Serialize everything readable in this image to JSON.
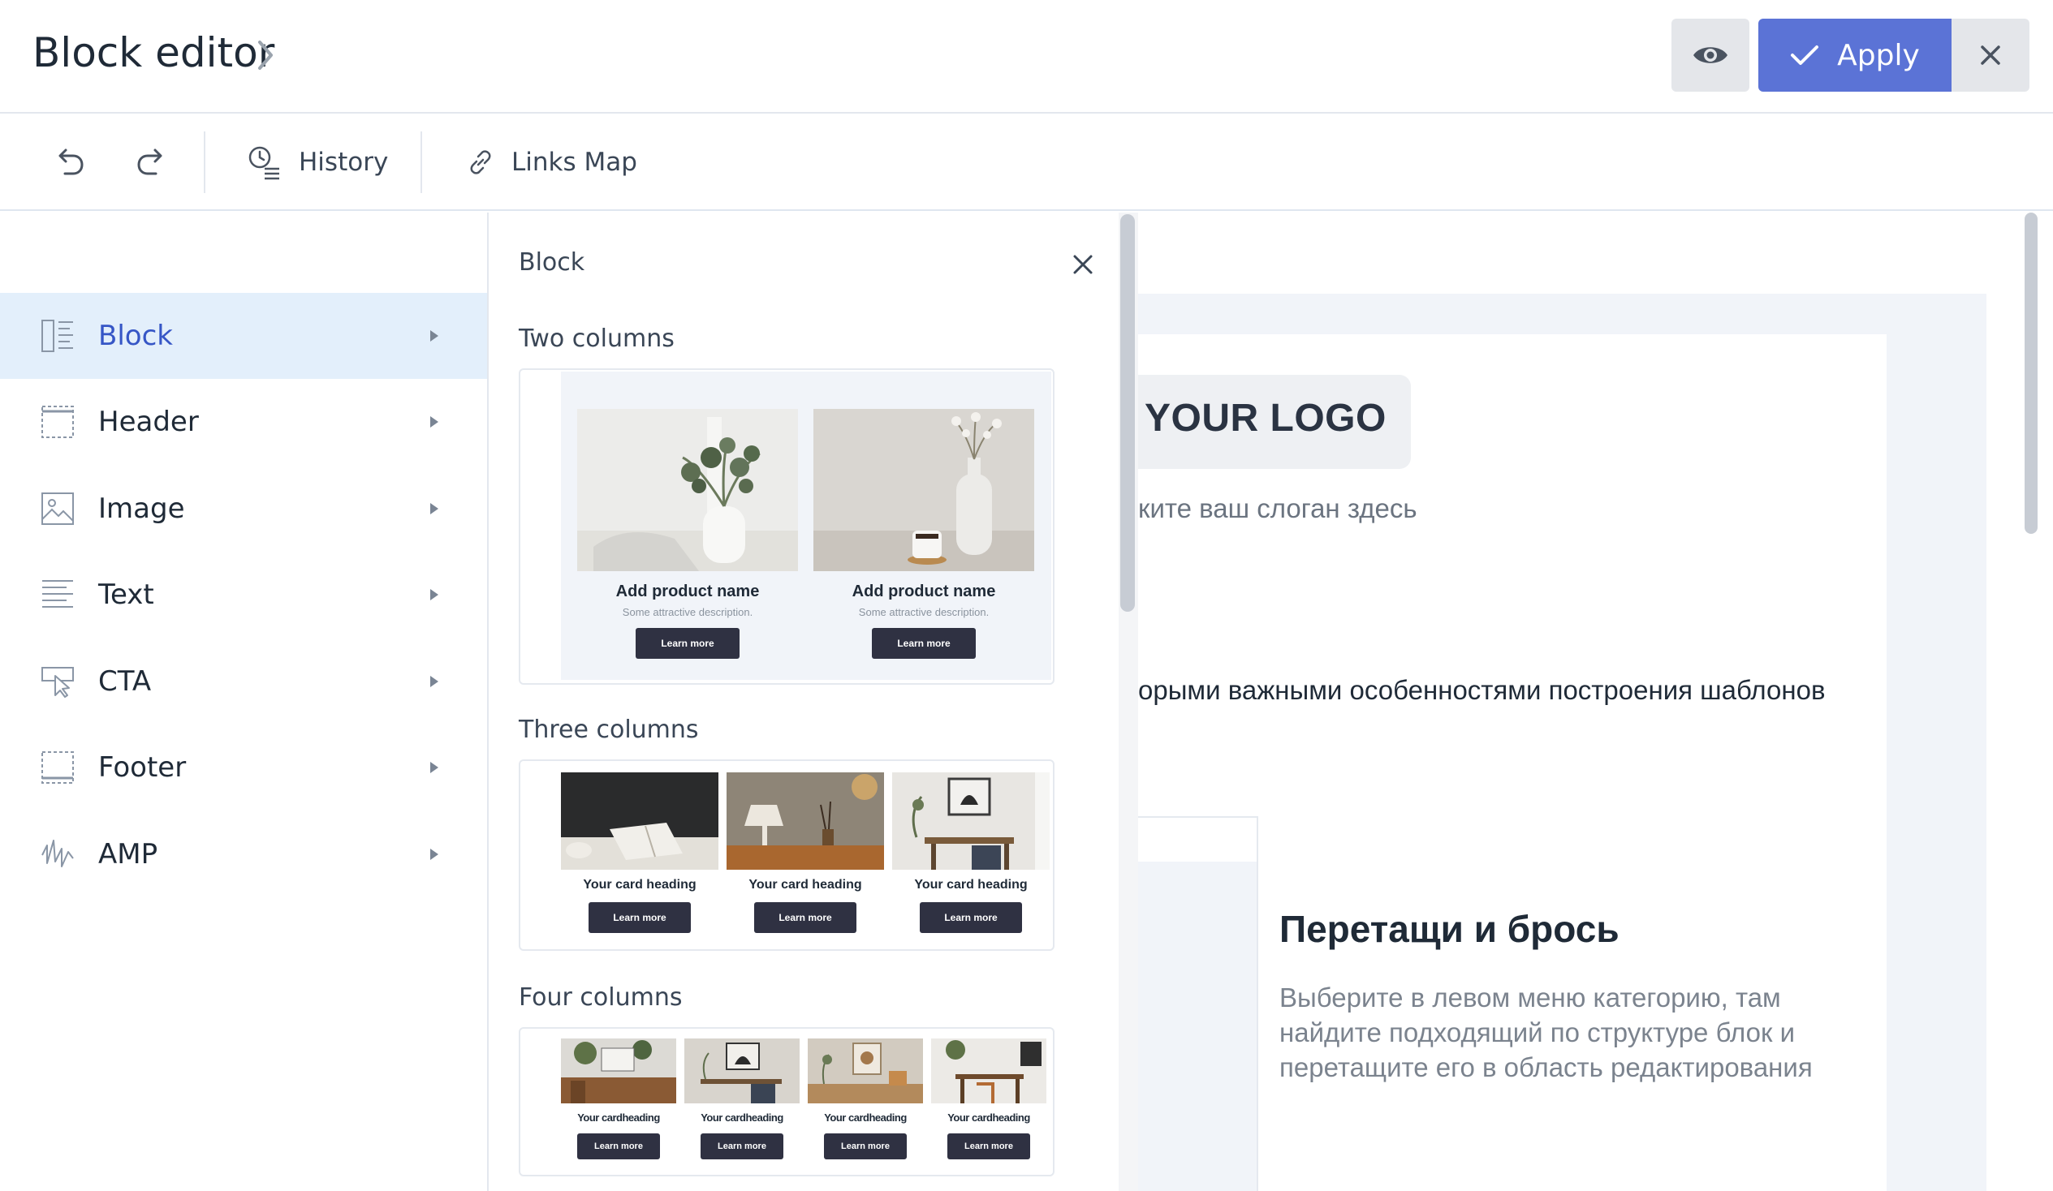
{
  "header": {
    "title": "Block editor",
    "apply_label": "Apply"
  },
  "toolbar": {
    "history_label": "History",
    "links_map_label": "Links Map"
  },
  "sidebar": {
    "items": [
      {
        "label": "Block",
        "icon": "block-icon",
        "active": true
      },
      {
        "label": "Header",
        "icon": "header-icon"
      },
      {
        "label": "Image",
        "icon": "image-icon"
      },
      {
        "label": "Text",
        "icon": "text-icon"
      },
      {
        "label": "CTA",
        "icon": "cta-icon"
      },
      {
        "label": "Footer",
        "icon": "footer-icon"
      },
      {
        "label": "AMP",
        "icon": "amp-icon"
      }
    ]
  },
  "panel": {
    "title": "Block",
    "two_columns": {
      "title": "Two columns",
      "products": [
        {
          "name": "Add product name",
          "description": "Some attractive description.",
          "button": "Learn more"
        },
        {
          "name": "Add product name",
          "description": "Some attractive description.",
          "button": "Learn more"
        }
      ]
    },
    "three_columns": {
      "title": "Three columns",
      "cards": [
        {
          "heading": "Your card heading",
          "button": "Learn more"
        },
        {
          "heading": "Your card heading",
          "button": "Learn more"
        },
        {
          "heading": "Your card heading",
          "button": "Learn more"
        }
      ]
    },
    "four_columns": {
      "title": "Four columns",
      "cards": [
        {
          "heading": "Your cardheading",
          "button": "Learn more"
        },
        {
          "heading": "Your cardheading",
          "button": "Learn more"
        },
        {
          "heading": "Your cardheading",
          "button": "Learn more"
        },
        {
          "heading": "Your cardheading",
          "button": "Learn more"
        }
      ]
    }
  },
  "canvas": {
    "logo": "YOUR LOGO",
    "slogan": "ките ваш слоган здесь",
    "body_text": "орыми важными особенностями построения шаблонов",
    "drop_title": "Перетащи и брось",
    "drop_text": "Выберите в левом меню категорию, там найдите подходящий по структуре блок и перетащите его в область редактирования"
  },
  "colors": {
    "accent": "#5b73d6",
    "active_bg": "#e3effb",
    "active_text": "#3656c6",
    "dark_button": "#2f3142"
  }
}
